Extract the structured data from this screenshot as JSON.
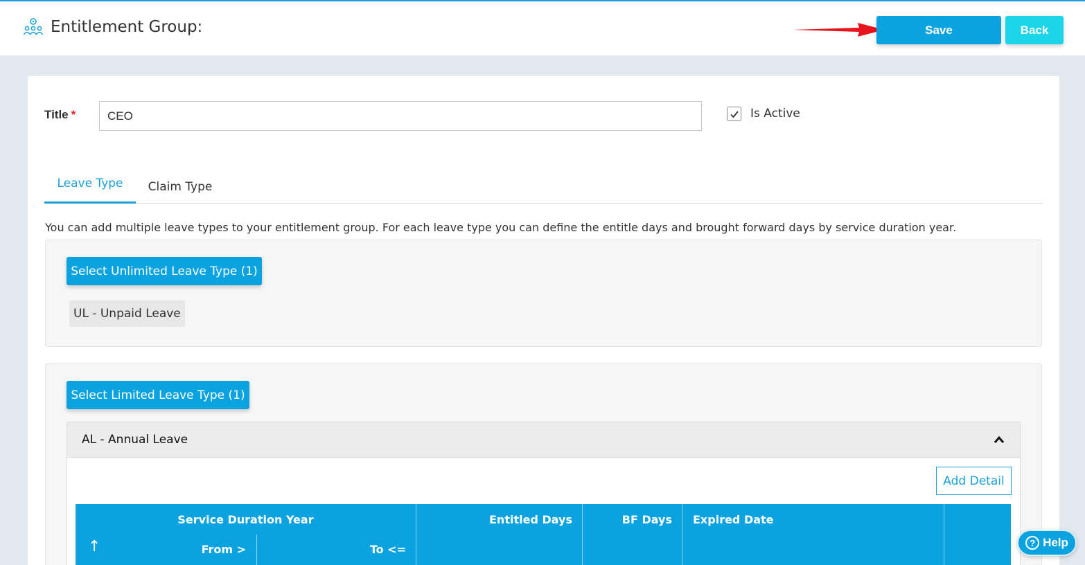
{
  "header": {
    "title": "Entitlement Group:",
    "save_label": "Save",
    "back_label": "Back"
  },
  "form": {
    "title_label": "Title",
    "required_mark": "*",
    "title_value": "CEO",
    "is_active_label": "Is Active",
    "is_active_checked": true
  },
  "tabs": [
    {
      "label": "Leave Type",
      "active": true
    },
    {
      "label": "Claim Type",
      "active": false
    }
  ],
  "description": "You can add multiple leave types to your entitlement group. For each leave type you can define the entitle days and brought forward days by service duration year.",
  "unlimited": {
    "button_label": "Select Unlimited Leave Type (1)",
    "items": [
      "UL - Unpaid Leave"
    ]
  },
  "limited": {
    "button_label": "Select Limited Leave Type (1)",
    "accordion_title": "AL - Annual Leave",
    "add_detail_label": "Add Detail",
    "table": {
      "group_header": "Service Duration Year",
      "sort_icon": "↑",
      "from_label": "From >",
      "to_label": "To <=",
      "entitled_days": "Entitled Days",
      "bf_days": "BF Days",
      "expired_date": "Expired Date"
    }
  },
  "help_label": "Help",
  "colors": {
    "primary": "#0aa3e0",
    "back_button": "#1ad6e8",
    "required": "#e0262d",
    "annotation_arrow": "#e8141c"
  }
}
